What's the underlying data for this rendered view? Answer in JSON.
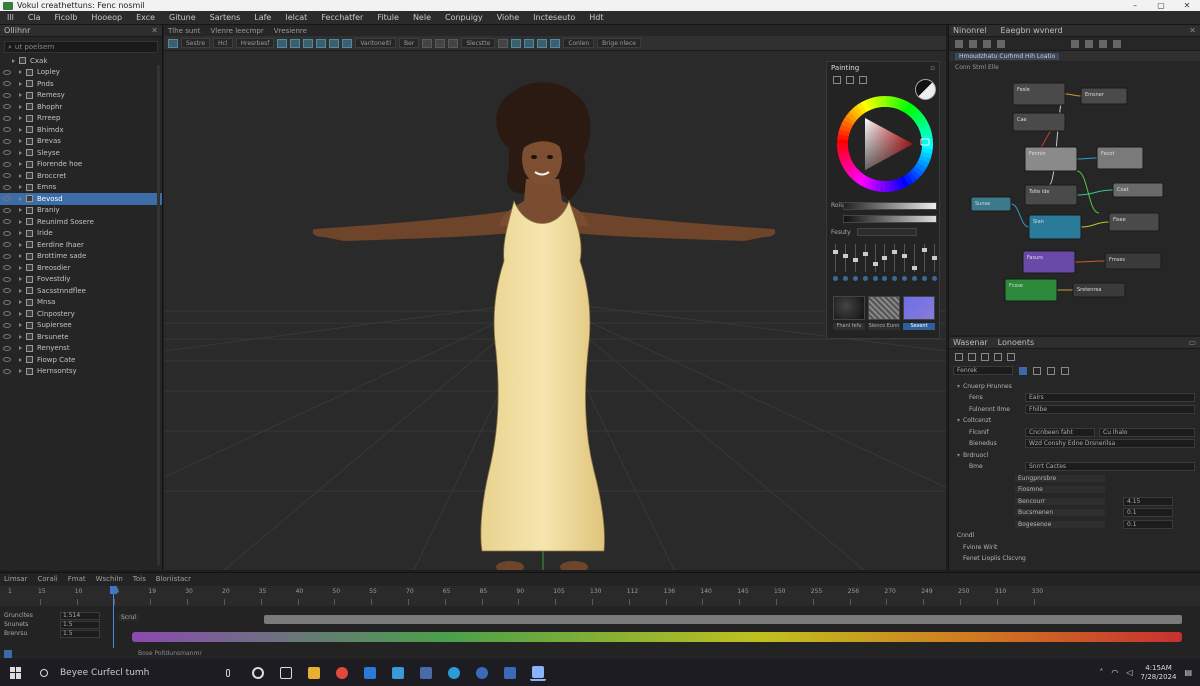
{
  "window": {
    "title": "Vokul creathettuns: Fenc nosmil",
    "buttons": [
      "–",
      "▢",
      "✕"
    ]
  },
  "menu": [
    "Ill",
    "Cla",
    "Ficolb",
    "Hooeop",
    "Exce",
    "Gitune",
    "Sartens",
    "Lafe",
    "Ielcat",
    "Fecchatfer",
    "Fitule",
    "Nele",
    "Conpuigy",
    "Viohe",
    "Incteseuto",
    "Hdt"
  ],
  "outliner": {
    "title": "Ollihnr",
    "search_placeholder": "ut poelsern",
    "root": "Cxak",
    "items": [
      {
        "label": "Lopley",
        "selected": false
      },
      {
        "label": "Pnds",
        "selected": false
      },
      {
        "label": "Remesy",
        "selected": false
      },
      {
        "label": "Bhophr",
        "selected": false
      },
      {
        "label": "Rrreep",
        "selected": false
      },
      {
        "label": "Bhimdx",
        "selected": false
      },
      {
        "label": "Brevas",
        "selected": false
      },
      {
        "label": "Sleyse",
        "selected": false
      },
      {
        "label": "Fiorende hoe",
        "selected": false
      },
      {
        "label": "Broccret",
        "selected": false
      },
      {
        "label": "Emns",
        "selected": false
      },
      {
        "label": "Bevosd",
        "selected": true
      },
      {
        "label": "Braniy",
        "selected": false
      },
      {
        "label": "Reunimd Sosere",
        "selected": false
      },
      {
        "label": "Iride",
        "selected": false
      },
      {
        "label": "Eerdine Ihaer",
        "selected": false
      },
      {
        "label": "Brottime sade",
        "selected": false
      },
      {
        "label": "Breosdier",
        "selected": false
      },
      {
        "label": "Fovestdiy",
        "selected": false
      },
      {
        "label": "Sacsstnndflee",
        "selected": false
      },
      {
        "label": "Mnsa",
        "selected": false
      },
      {
        "label": "Clnpostery",
        "selected": false
      },
      {
        "label": "Supiersee",
        "selected": false
      },
      {
        "label": "Brsunete",
        "selected": false
      },
      {
        "label": "Renyenst",
        "selected": false
      },
      {
        "label": "Fiowp Cate",
        "selected": false
      },
      {
        "label": "Hernsontsy",
        "selected": false
      }
    ]
  },
  "viewport": {
    "tabs": [
      "Tlhe sunt",
      "Vlenre leecmpr",
      "Vresienre"
    ],
    "toolbar_items": [
      "Sestre",
      "Hcl",
      "Hresrbesf",
      "Varitoneitl",
      "Ber"
    ],
    "dropdowns": [
      "Slecstte",
      "Conlen",
      "Brige nlece"
    ]
  },
  "color_panel": {
    "title": "Painting",
    "labels": {
      "hue": "Roila",
      "value": "Fesuty"
    },
    "thumbs": [
      "Fhanl fefu",
      "Slenco Eunn",
      "Sesent"
    ],
    "colors": {
      "hue_marker": "#e22020",
      "selected_swatch": "#111111"
    }
  },
  "node_editor": {
    "title": "Ninonrel",
    "tabs": [
      "Eaegbn wvnerd"
    ],
    "breadcrumb": "Hmoudzhatu Curhmd Hih Loatio",
    "search": "Conn  Stml Elle",
    "nodes": [
      {
        "label": "Fesle",
        "color": "#4a4a4a"
      },
      {
        "label": "Emsner",
        "color": "#4a4a4a"
      },
      {
        "label": "Cae",
        "color": "#4a4a4a"
      },
      {
        "label": "Fennin",
        "color": "#4a4a4a"
      },
      {
        "label": "Fecot",
        "color": "#4a4a4a"
      },
      {
        "label": "Tslte ide",
        "color": "#8a8a8a"
      },
      {
        "label": "Coat",
        "color": "#4a4a4a"
      },
      {
        "label": "Sunse",
        "color": "#8a8a8a"
      },
      {
        "label": "Slan",
        "color": "#3a7a8a"
      },
      {
        "label": "Fisee",
        "color": "#2a7a9a"
      },
      {
        "label": "Fasurs",
        "color": "#4a4a4a"
      },
      {
        "label": "Fmses",
        "color": "#6a4aa8"
      },
      {
        "label": "Fcsse",
        "color": "#3a3a3a"
      },
      {
        "label": "Sretenrea",
        "color": "#2a8a3a"
      },
      {
        "label": "Fcsr",
        "color": "#3a3a3a"
      }
    ]
  },
  "properties": {
    "tabs": [
      "Wasenar",
      "Lonoents"
    ],
    "filter": "Fenrek",
    "sections": [
      {
        "label": "Cnuerp Hrunnes"
      },
      {
        "label": "Fens",
        "value": "Eairs"
      },
      {
        "label": "Fulnennt Ilme",
        "value": "Fhilbe"
      },
      {
        "label": "Coltcenzt"
      },
      {
        "label": "Flconif",
        "value": "Cncnbeen faht",
        "value2": "Cu Ihalo"
      },
      {
        "label": "Bienedus",
        "value": "Wzd Conshy  Edne  Drsnerilsa"
      },
      {
        "label": "Brdruocl"
      },
      {
        "label": "Bme",
        "value": "Snrrt Cactes"
      }
    ],
    "subrows": [
      {
        "label": "Eungpnrsbre",
        "value": ""
      },
      {
        "label": "Fiosmne",
        "value": ""
      },
      {
        "label": "Bencourr",
        "value": "4.15"
      },
      {
        "label": "Bucsmenen",
        "value": "0.1"
      },
      {
        "label": "Bogesenoe",
        "value": "0.1"
      }
    ],
    "footer": [
      "Cnndl",
      "Fvinre Wirit",
      "Fenet Lioplis Clscvng"
    ]
  },
  "timeline": {
    "tabs": [
      "Limsar",
      "Corali",
      "Fmat",
      "Wschiln",
      "Tois",
      "Bloriistacr"
    ],
    "ticks": [
      "15",
      "10",
      "14",
      "19",
      "30",
      "20",
      "35",
      "40",
      "50",
      "55",
      "70",
      "65",
      "85",
      "90",
      "105",
      "130",
      "112",
      "136",
      "140",
      "145",
      "150",
      "255",
      "256",
      "270",
      "249",
      "250",
      "310",
      "330"
    ],
    "current_frame": "1",
    "tracks": [
      {
        "name": "Gruncltes",
        "value": "1.514"
      },
      {
        "name": "Snunets",
        "value": "1.5"
      },
      {
        "name": "Brenrsu",
        "value": "1.5"
      }
    ],
    "track_label": "Scrul",
    "footer": "Bose Poltdunsmanmr"
  },
  "taskbar": {
    "search_placeholder": "Beyee Curfecl tumh",
    "time": "4:15AM",
    "date": "7/28/2024",
    "apps": [
      "cortana",
      "task-view",
      "file-explorer",
      "chrome",
      "vscode",
      "app-store",
      "mail",
      "edge",
      "steam",
      "settings",
      "photos"
    ]
  }
}
